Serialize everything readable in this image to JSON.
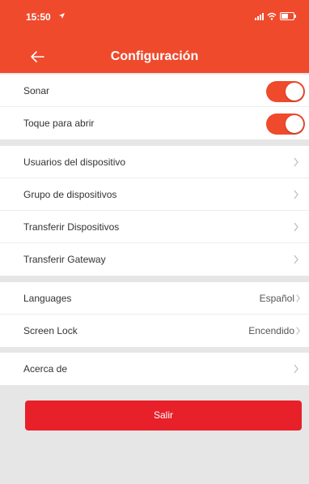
{
  "status_bar": {
    "time": "15:50"
  },
  "header": {
    "title": "Configuración"
  },
  "settings": {
    "toggles": [
      {
        "label": "Sonar",
        "on": true
      },
      {
        "label": "Toque para abrir",
        "on": true
      }
    ],
    "devices": [
      {
        "label": "Usuarios del dispositivo"
      },
      {
        "label": "Grupo de dispositivos"
      },
      {
        "label": "Transferir Dispositivos"
      },
      {
        "label": "Transferir Gateway"
      }
    ],
    "prefs": [
      {
        "label": "Languages",
        "value": "Español"
      },
      {
        "label": "Screen Lock",
        "value": "Encendido"
      }
    ],
    "about": {
      "label": "Acerca de"
    }
  },
  "logout": {
    "label": "Salir"
  },
  "colors": {
    "accent": "#ef4a2c",
    "button": "#e8202a",
    "background": "#e6e6e6"
  },
  "icons": [
    "back-arrow-icon",
    "location-arrow-icon",
    "signal-icon",
    "wifi-icon",
    "battery-icon",
    "chevron-right-icon"
  ]
}
